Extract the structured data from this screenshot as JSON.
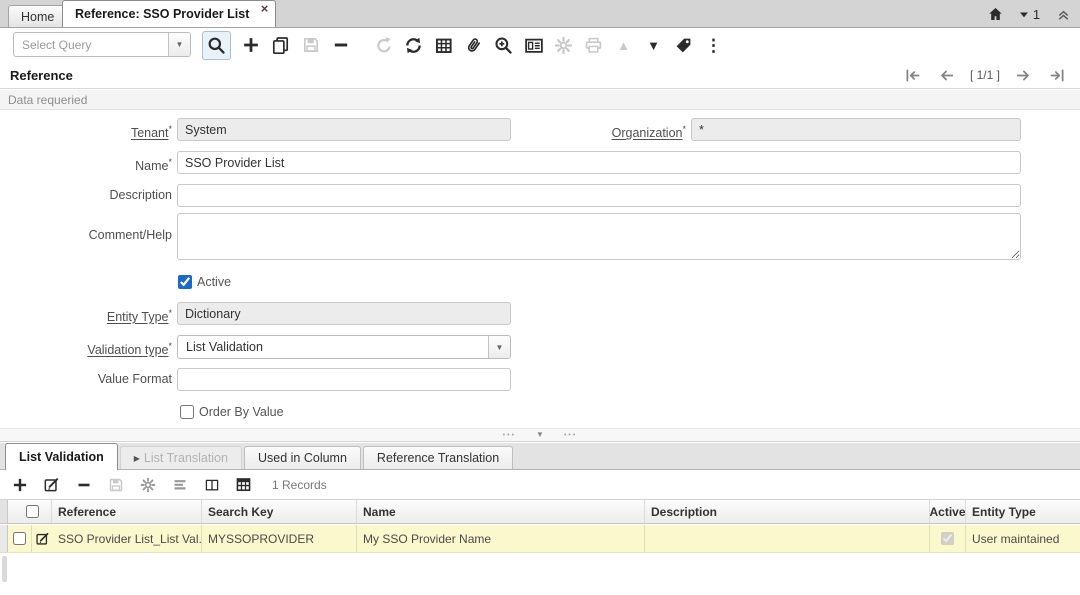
{
  "window": {
    "tabs": [
      {
        "label": "Home"
      },
      {
        "label": "Reference: SSO Provider List",
        "close_glyph": "×"
      }
    ],
    "open_windows_count": "1"
  },
  "toolbar": {
    "select_query_placeholder": "Select Query"
  },
  "header": {
    "title": "Reference",
    "record_position": "[ 1/1 ]"
  },
  "statusbar": {
    "message": "Data requeried"
  },
  "form": {
    "tenant": {
      "label": "Tenant",
      "star": "*",
      "value": "System"
    },
    "organization": {
      "label": "Organization",
      "star": "*",
      "value": "*"
    },
    "name": {
      "label": "Name",
      "star": "*",
      "value": "SSO Provider List"
    },
    "description": {
      "label": "Description",
      "value": ""
    },
    "comment_help": {
      "label": "Comment/Help",
      "value": ""
    },
    "active": {
      "label": "Active",
      "checked": true
    },
    "entity_type": {
      "label": "Entity Type",
      "star": "*",
      "value": "Dictionary"
    },
    "validation_type": {
      "label": "Validation type",
      "star": "*",
      "value": "List Validation"
    },
    "value_format": {
      "label": "Value Format",
      "value": ""
    },
    "order_by_value": {
      "label": "Order By Value",
      "checked": false
    }
  },
  "detail": {
    "tabs": [
      {
        "label": "List Validation",
        "state": "active"
      },
      {
        "label": "List Translation",
        "state": "disabled"
      },
      {
        "label": "Used in Column",
        "state": "normal"
      },
      {
        "label": "Reference Translation",
        "state": "normal"
      }
    ],
    "records_text": "1 Records",
    "table": {
      "columns": [
        "Reference",
        "Search Key",
        "Name",
        "Description",
        "Active",
        "Entity Type"
      ],
      "rows": [
        {
          "reference": "SSO Provider List_List Val...",
          "search_key": "MYSSOPROVIDER",
          "name": "My SSO Provider Name",
          "description": "",
          "active": true,
          "entity_type": "User maintained"
        }
      ]
    }
  },
  "icons": {
    "combo_arrow": "▼",
    "nav_up_glyph": "▲",
    "nav_down_glyph": "▼",
    "kebab_glyph": "⋮",
    "splitter_dots": "•••",
    "splitter_arrow": "▼",
    "disabled_tab_marker": "▶"
  },
  "colors": {
    "accent_blue": "#1b6ac9",
    "row_highlight": "#fbf8cd",
    "tab_close": "#5d3a3a"
  }
}
